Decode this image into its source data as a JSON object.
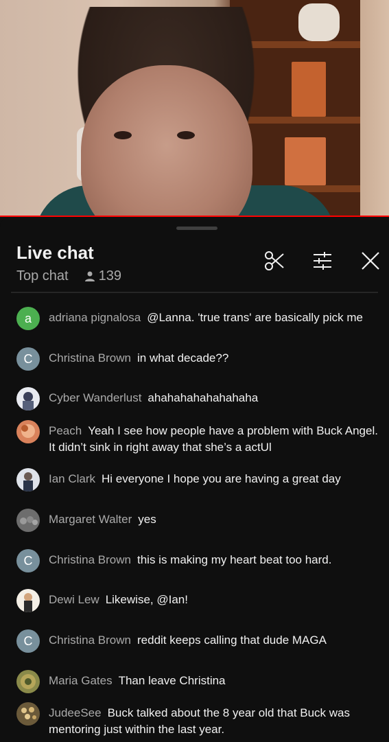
{
  "chat": {
    "title": "Live chat",
    "mode": "Top chat",
    "viewer_count": "139"
  },
  "icons": {
    "clip": "scissors-icon",
    "settings": "sliders-icon",
    "close": "close-icon",
    "viewers": "person-icon"
  },
  "colors": {
    "background": "#0f0f0f",
    "progress": "#ff0000",
    "author": "#aaaaaa"
  },
  "messages": [
    {
      "author": "adriana pignalosa",
      "text": "@Lanna. 'true trans' are basically pick me",
      "avatar": {
        "type": "letter",
        "letter": "a",
        "color": "#4caf50"
      }
    },
    {
      "author": "Christina Brown",
      "text": "in what decade??",
      "avatar": {
        "type": "letter",
        "letter": "C",
        "color": "#78909c"
      }
    },
    {
      "author": "Cyber Wanderlust",
      "text": "ahahahahahahahaha",
      "avatar": {
        "type": "image",
        "color": "#e8eaf0"
      }
    },
    {
      "author": "Peach",
      "text": "Yeah I see how people have a problem with Buck Angel. It didn’t sink in right away that she’s a actUl",
      "avatar": {
        "type": "image",
        "color": "#d9825b"
      }
    },
    {
      "author": "Ian Clark",
      "text": "Hi everyone I hope you are having a great day",
      "avatar": {
        "type": "image",
        "color": "#dfe3ea"
      }
    },
    {
      "author": "Margaret Walter",
      "text": "yes",
      "avatar": {
        "type": "image",
        "color": "#6d6d6d"
      }
    },
    {
      "author": "Christina Brown",
      "text": "this is making my heart beat too hard.",
      "avatar": {
        "type": "letter",
        "letter": "C",
        "color": "#78909c"
      }
    },
    {
      "author": "Dewi Lew",
      "text": "Likewise, @Ian!",
      "avatar": {
        "type": "image",
        "color": "#f4efe6"
      }
    },
    {
      "author": "Christina Brown",
      "text": "reddit keeps calling that dude MAGA",
      "avatar": {
        "type": "letter",
        "letter": "C",
        "color": "#78909c"
      }
    },
    {
      "author": "Maria Gates",
      "text": "Than leave Christina",
      "avatar": {
        "type": "image",
        "color": "#8a8a4a"
      }
    },
    {
      "author": "JudeeSee",
      "text": "Buck talked about the 8 year old that Buck was mentoring just within the last year.",
      "avatar": {
        "type": "image",
        "color": "#6b5a3a"
      }
    }
  ]
}
